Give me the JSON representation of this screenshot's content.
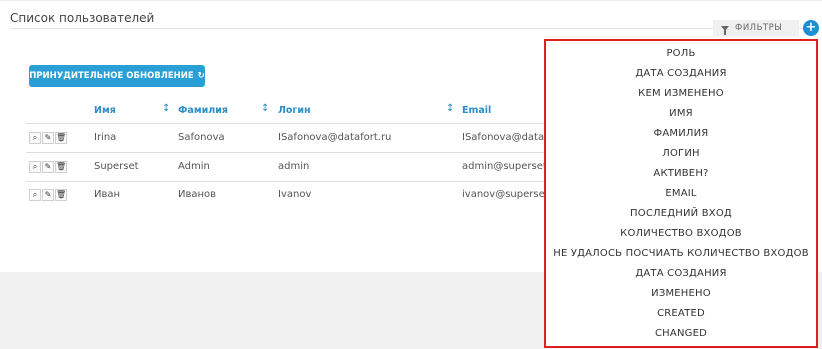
{
  "panel": {
    "title": "Список пользователей"
  },
  "filters": {
    "label": "ФИЛЬТРЫ",
    "add_label": "+"
  },
  "refresh": {
    "label": "ПРИНУДИТЕЛЬНОЕ ОБНОВЛЕНИЕ",
    "icon": "↻"
  },
  "table": {
    "columns": [
      "Имя",
      "Фамилия",
      "Логин",
      "Email"
    ],
    "rows": [
      [
        "Irina",
        "Safonova",
        "ISafonova@datafort.ru",
        "ISafonova@datafc"
      ],
      [
        "Superset",
        "Admin",
        "admin",
        "admin@superset"
      ],
      [
        "Иван",
        "Иванов",
        "Ivanov",
        "ivanov@superset"
      ]
    ]
  },
  "dropdown": {
    "items": [
      "РОЛЬ",
      "ДАТА СОЗДАНИЯ",
      "КЕМ ИЗМЕНЕНО",
      "ИМЯ",
      "ФАМИЛИЯ",
      "ЛОГИН",
      "АКТИВЕН?",
      "EMAIL",
      "ПОСЛЕДНИЙ ВХОД",
      "КОЛИЧЕСТВО ВХОДОВ",
      "НЕ УДАЛОСЬ ПОСЧИАТЬ КОЛИЧЕСТВО ВХОДОВ",
      "ДАТА СОЗДАНИЯ",
      "ИЗМЕНЕНО",
      "CREATED",
      "CHANGED"
    ]
  },
  "colors": {
    "accent": "#2a9fd6",
    "highlight_border": "#e02020"
  }
}
